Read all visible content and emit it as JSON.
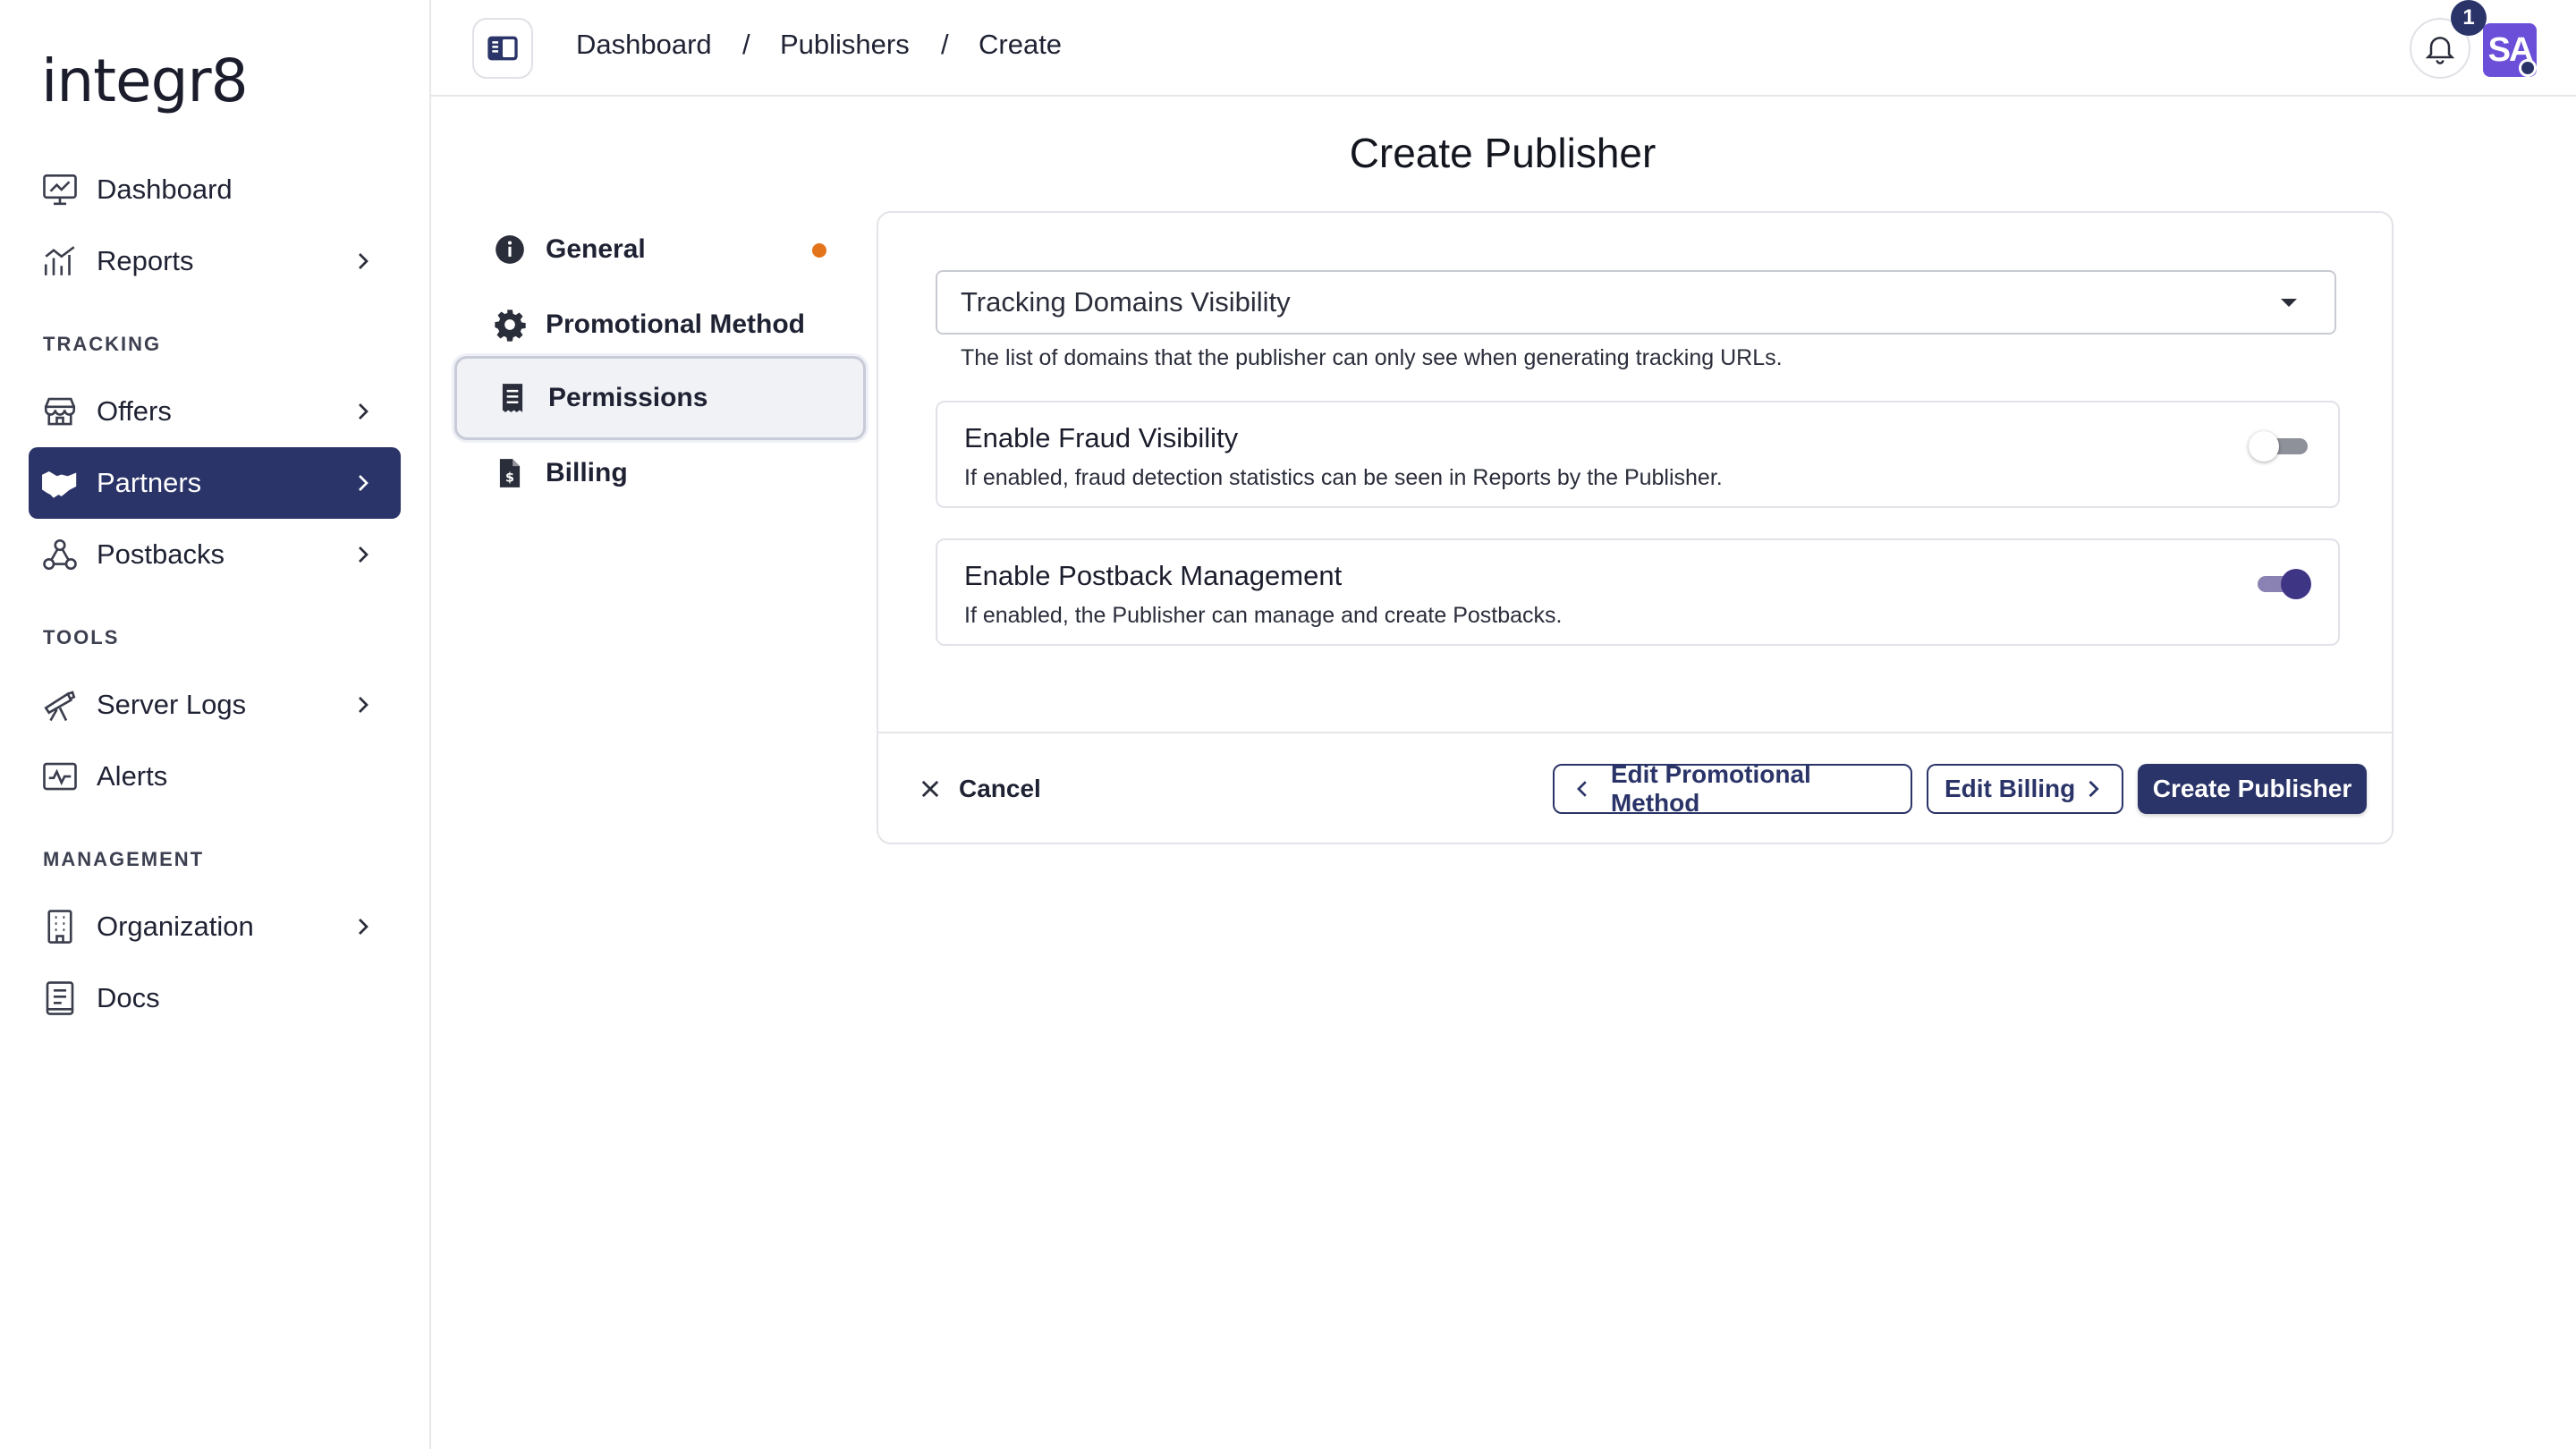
{
  "brand": {
    "logo_text": "integr8"
  },
  "sidebar": {
    "items_top": [
      {
        "label": "Dashboard",
        "icon": "chart-monitor-icon",
        "has_chevron": false
      },
      {
        "label": "Reports",
        "icon": "bar-chart-icon",
        "has_chevron": true
      }
    ],
    "sections": [
      {
        "label": "TRACKING",
        "items": [
          {
            "label": "Offers",
            "icon": "storefront-icon",
            "has_chevron": true
          },
          {
            "label": "Partners",
            "icon": "handshake-icon",
            "has_chevron": true,
            "active": true
          },
          {
            "label": "Postbacks",
            "icon": "webhook-icon",
            "has_chevron": true
          }
        ]
      },
      {
        "label": "TOOLS",
        "items": [
          {
            "label": "Server Logs",
            "icon": "telescope-icon",
            "has_chevron": true
          },
          {
            "label": "Alerts",
            "icon": "activity-icon",
            "has_chevron": false
          }
        ]
      },
      {
        "label": "MANAGEMENT",
        "items": [
          {
            "label": "Organization",
            "icon": "building-icon",
            "has_chevron": true
          },
          {
            "label": "Docs",
            "icon": "document-icon",
            "has_chevron": false
          }
        ]
      }
    ]
  },
  "topbar": {
    "breadcrumbs": [
      "Dashboard",
      "Publishers",
      "Create"
    ],
    "separator": "/",
    "notification_count": "1",
    "avatar_initials": "SA"
  },
  "page": {
    "title": "Create Publisher",
    "steps": [
      {
        "label": "General",
        "icon": "info-icon",
        "has_dot": true
      },
      {
        "label": "Promotional Method",
        "icon": "gear-icon"
      },
      {
        "label": "Permissions",
        "icon": "receipt-icon",
        "active": true
      },
      {
        "label": "Billing",
        "icon": "invoice-icon"
      }
    ],
    "select": {
      "value": "Tracking Domains Visibility",
      "helper": "The list of domains that the publisher can only see when generating tracking URLs."
    },
    "permissions": [
      {
        "title": "Enable Fraud Visibility",
        "description": "If enabled, fraud detection statistics can be seen in Reports by the Publisher.",
        "enabled": false
      },
      {
        "title": "Enable Postback Management",
        "description": "If enabled, the Publisher can manage and create Postbacks.",
        "enabled": true
      }
    ],
    "footer": {
      "cancel": "Cancel",
      "prev": "Edit Promotional Method",
      "next": "Edit Billing",
      "submit": "Create Publisher"
    }
  },
  "colors": {
    "primary": "#2b3468",
    "accent_dot": "#e3741c",
    "avatar": "#6b4fd8",
    "toggle_on": "#3f3585"
  }
}
